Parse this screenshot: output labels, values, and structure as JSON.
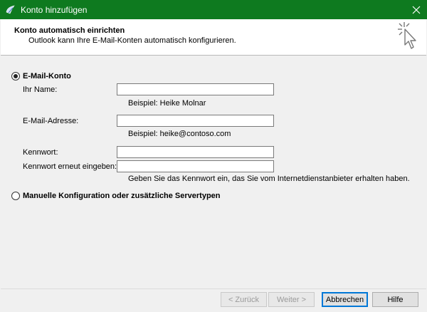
{
  "window": {
    "title": "Konto hinzufügen",
    "accent": "#0e7a1f"
  },
  "header": {
    "title": "Konto automatisch einrichten",
    "subtitle": "Outlook kann Ihre E-Mail-Konten automatisch konfigurieren."
  },
  "email_account": {
    "radio_label": "E-Mail-Konto",
    "selected": true,
    "name_label": "Ihr Name:",
    "name_value": "",
    "name_hint": "Beispiel: Heike Molnar",
    "email_label": "E-Mail-Adresse:",
    "email_value": "",
    "email_hint": "Beispiel: heike@contoso.com",
    "password_label": "Kennwort:",
    "password_value": "",
    "password_repeat_label": "Kennwort erneut eingeben:",
    "password_repeat_value": "",
    "password_hint": "Geben Sie das Kennwort ein, das Sie vom Internetdienstanbieter erhalten haben."
  },
  "manual_config": {
    "radio_label": "Manuelle Konfiguration oder zusätzliche Servertypen",
    "selected": false
  },
  "footer": {
    "back_label": "< Zurück",
    "next_label": "Weiter >",
    "cancel_label": "Abbrechen",
    "help_label": "Hilfe"
  },
  "icons": {
    "app": "outlook-app-icon",
    "close": "close-icon",
    "wizard": "cursor-sparkle-icon"
  }
}
